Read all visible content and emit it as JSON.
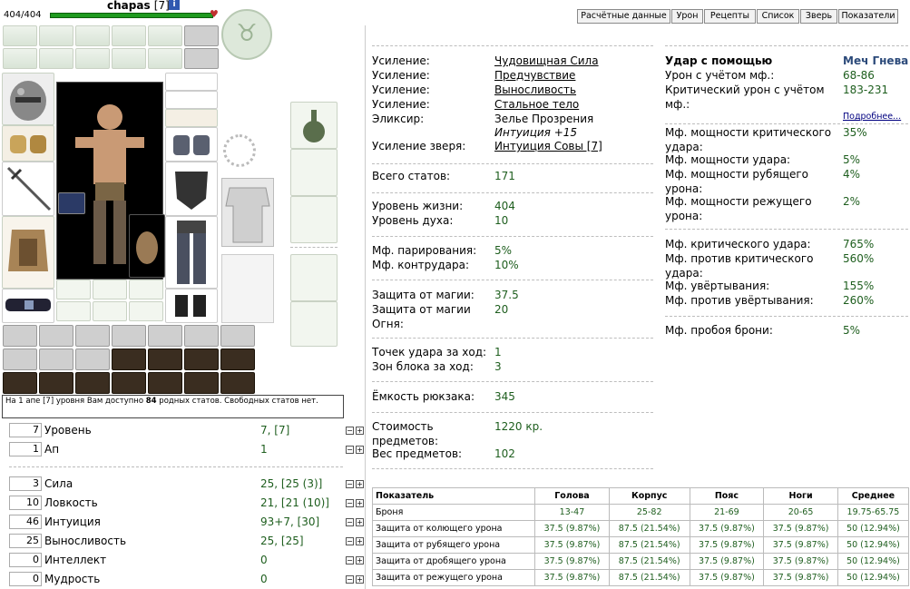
{
  "header": {
    "hp_text": "404/404",
    "name": "chapas",
    "level": "[7]",
    "info_icon": "i"
  },
  "tabs": [
    "Расчётные данные",
    "Урон",
    "Рецепты",
    "Список",
    "Зверь",
    "Показатели"
  ],
  "info_notice": {
    "prefix": "На 1 апе [7] уровня Вам доступно ",
    "count": "84",
    "suffix": " родных статов. Свободных статов нет."
  },
  "stats_top": [
    {
      "input": "7",
      "label": "Уровень",
      "value": "7, [7]"
    },
    {
      "input": "1",
      "label": "Ап",
      "value": "1"
    }
  ],
  "stats": [
    {
      "input": "3",
      "label": "Сила",
      "value": "25, [25 (3)]"
    },
    {
      "input": "10",
      "label": "Ловкость",
      "value": "21, [21 (10)]"
    },
    {
      "input": "46",
      "label": "Интуиция",
      "value": "93+7, [30]"
    },
    {
      "input": "25",
      "label": "Выносливость",
      "value": "25, [25]"
    },
    {
      "input": "0",
      "label": "Интеллект",
      "value": "0"
    },
    {
      "input": "0",
      "label": "Мудрость",
      "value": "0"
    }
  ],
  "buffs": [
    {
      "label": "Усиление:",
      "value": "Чудовищная Сила"
    },
    {
      "label": "Усиление:",
      "value": "Предчувствие"
    },
    {
      "label": "Усиление:",
      "value": "Выносливость"
    },
    {
      "label": "Усиление:",
      "value": "Стальное тело"
    },
    {
      "label": "Эликсир:",
      "value": "Зелье Прозрения",
      "extra": "Интуиция +15"
    },
    {
      "label": "Усиление зверя:",
      "value": "Интуиция Совы [7]"
    }
  ],
  "calc": {
    "total_stats_label": "Всего статов:",
    "total_stats": "171",
    "hp_label": "Уровень жизни:",
    "hp": "404",
    "mana_label": "Уровень духа:",
    "mana": "10",
    "parry_label": "Мф. парирования:",
    "parry": "5%",
    "counter_label": "Мф. контрудара:",
    "counter": "10%",
    "magic_def_label": "Защита от магии:",
    "magic_def": "37.5",
    "fire_def_label": "Защита от магии Огня:",
    "fire_def": "20",
    "hits_label": "Точек удара за ход:",
    "hits": "1",
    "blocks_label": "Зон блока за ход:",
    "blocks": "3",
    "backpack_label": "Ёмкость рюкзака:",
    "backpack": "345",
    "cost_label": "Стоимость предметов:",
    "cost": "1220 кр.",
    "weight_label": "Вес предметов:",
    "weight": "102"
  },
  "strike": {
    "title": "Удар с помощью",
    "weapon": "Меч Гнева",
    "dmg_label": "Урон с учётом мф.:",
    "dmg": "68-86",
    "crit_dmg_label": "Критический урон с учётом мф.:",
    "crit_dmg": "183-231",
    "more_link": "Подробнее...",
    "crit_power_label": "Мф. мощности критического удара:",
    "crit_power": "35%",
    "hit_power_label": "Мф. мощности удара:",
    "hit_power": "5%",
    "chop_power_label": "Мф. мощности рубящего урона:",
    "chop_power": "4%",
    "cut_power_label": "Мф. мощности режущего урона:",
    "cut_power": "2%",
    "crit_label": "Мф. критического удара:",
    "crit": "765%",
    "anticrit_label": "Мф. против критического удара:",
    "anticrit": "560%",
    "dodge_label": "Мф. увёртывания:",
    "dodge": "155%",
    "antidodge_label": "Мф. против увёртывания:",
    "antidodge": "260%",
    "pierce_label": "Мф. пробоя брони:",
    "pierce": "5%"
  },
  "armor_table": {
    "headers": [
      "Показатель",
      "Голова",
      "Корпус",
      "Пояс",
      "Ноги",
      "Среднее"
    ],
    "rows": [
      [
        "Броня",
        "13-47",
        "25-82",
        "21-69",
        "20-65",
        "19.75-65.75"
      ],
      [
        "Защита от колющего урона",
        "37.5 (9.87%)",
        "87.5 (21.54%)",
        "37.5 (9.87%)",
        "37.5 (9.87%)",
        "50 (12.94%)"
      ],
      [
        "Защита от рубящего урона",
        "37.5 (9.87%)",
        "87.5 (21.54%)",
        "37.5 (9.87%)",
        "37.5 (9.87%)",
        "50 (12.94%)"
      ],
      [
        "Защита от дробящего урона",
        "37.5 (9.87%)",
        "87.5 (21.54%)",
        "37.5 (9.87%)",
        "37.5 (9.87%)",
        "50 (12.94%)"
      ],
      [
        "Защита от режущего урона",
        "37.5 (9.87%)",
        "87.5 (21.54%)",
        "37.5 (9.87%)",
        "37.5 (9.87%)",
        "50 (12.94%)"
      ]
    ]
  },
  "colors": {
    "hp_bar": "#1f9a1f",
    "accent_text": "#1e5e1e",
    "link": "#000080",
    "weapon_name": "#2c4a7a"
  }
}
